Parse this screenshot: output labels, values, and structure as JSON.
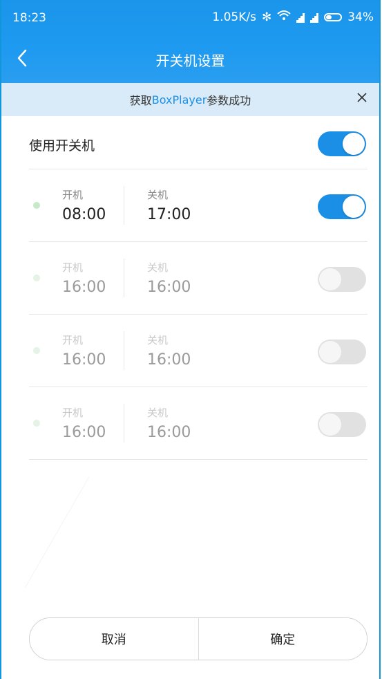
{
  "status_bar": {
    "time": "18:23",
    "speed": "1.05K/s",
    "battery": "34%"
  },
  "title_bar": {
    "title": "开关机设置"
  },
  "toast": {
    "prefix": "获取",
    "highlight": "BoxPlayer",
    "suffix": "参数成功"
  },
  "master": {
    "label": "使用开关机",
    "enabled": true
  },
  "schedules": [
    {
      "on_label": "开机",
      "on_time": "08:00",
      "off_label": "关机",
      "off_time": "17:00",
      "enabled": true
    },
    {
      "on_label": "开机",
      "on_time": "16:00",
      "off_label": "关机",
      "off_time": "16:00",
      "enabled": false
    },
    {
      "on_label": "开机",
      "on_time": "16:00",
      "off_label": "关机",
      "off_time": "16:00",
      "enabled": false
    },
    {
      "on_label": "开机",
      "on_time": "16:00",
      "off_label": "关机",
      "off_time": "16:00",
      "enabled": false
    }
  ],
  "buttons": {
    "cancel": "取消",
    "confirm": "确定"
  },
  "colors": {
    "accent": "#1b8fe6",
    "toast_bg": "#d9ebf8",
    "dot_active": "#c7e8c9",
    "dot_inactive": "#e4f3e5"
  }
}
